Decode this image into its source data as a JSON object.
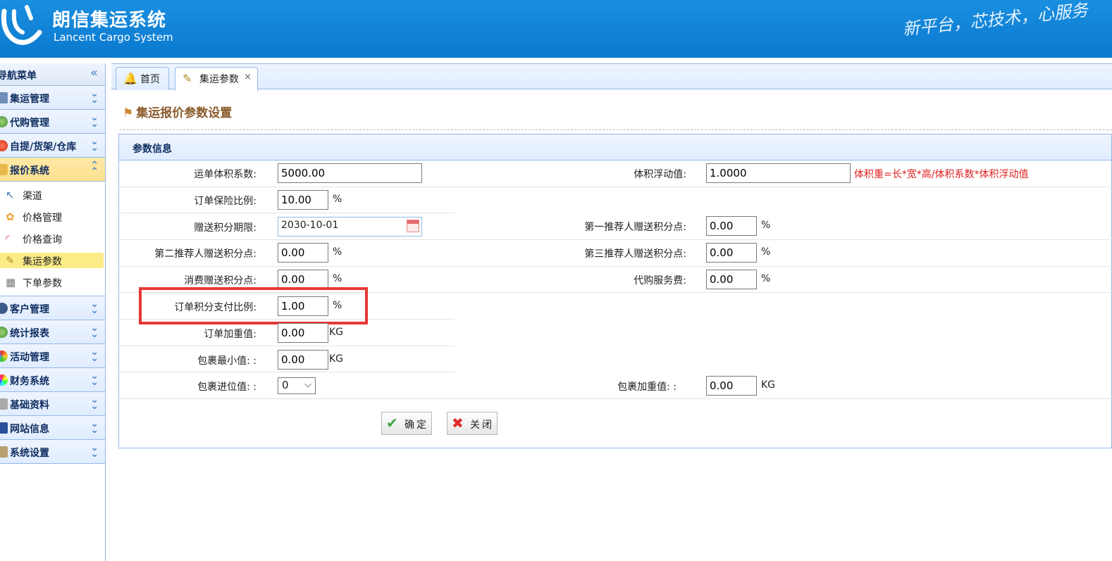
{
  "header": {
    "title": "朗信集运系统",
    "subtitle": "Lancent Cargo System",
    "slogan": "新平台，芯技术，心服务"
  },
  "nav": {
    "title": "导航菜单",
    "items": [
      {
        "label": "集运管理",
        "icon": "monitor-icon",
        "expanded": false
      },
      {
        "label": "代购管理",
        "icon": "globe-icon",
        "expanded": false
      },
      {
        "label": "自提/货架/仓库",
        "icon": "red-circle-icon",
        "expanded": false
      },
      {
        "label": "报价系统",
        "icon": "price-icon",
        "expanded": true,
        "children": [
          {
            "label": "渠道",
            "icon": "route-icon"
          },
          {
            "label": "价格管理",
            "icon": "flower-icon"
          },
          {
            "label": "价格查询",
            "icon": "rainbow-icon"
          },
          {
            "label": "集运参数",
            "icon": "pencil-icon",
            "selected": true
          },
          {
            "label": "下单参数",
            "icon": "grid-icon"
          }
        ]
      },
      {
        "label": "客户管理",
        "icon": "user-icon",
        "expanded": false
      },
      {
        "label": "统计报表",
        "icon": "globe-icon",
        "expanded": false
      },
      {
        "label": "活动管理",
        "icon": "rainbow-icon",
        "expanded": false
      },
      {
        "label": "财务系统",
        "icon": "color-wheel-icon",
        "expanded": false
      },
      {
        "label": "基础资料",
        "icon": "notes-icon",
        "expanded": false
      },
      {
        "label": "网站信息",
        "icon": "font-icon",
        "expanded": false
      },
      {
        "label": "系统设置",
        "icon": "wrench-icon",
        "expanded": false
      }
    ]
  },
  "tabs": [
    {
      "label": "首页",
      "icon": "bell-icon"
    },
    {
      "label": "集运参数",
      "icon": "pencil-icon",
      "close": "×",
      "active": true
    }
  ],
  "page": {
    "title": "集运报价参数设置",
    "panel_title": "参数信息"
  },
  "form": {
    "volume_coef": {
      "label": "运单体积系数:",
      "value": "5000.00"
    },
    "volume_float": {
      "label": "体积浮动值:",
      "value": "1.0000"
    },
    "volume_note": "体积重=长*宽*高/体积系数*体积浮动值",
    "insurance_ratio": {
      "label": "订单保险比例:",
      "value": "10.00",
      "unit": "%"
    },
    "points_expiry": {
      "label": "赠送积分期限:",
      "value": "2030-10-01"
    },
    "ref1_points": {
      "label": "第一推荐人赠送积分点:",
      "value": "0.00",
      "unit": "%"
    },
    "ref2_points": {
      "label": "第二推荐人赠送积分点:",
      "value": "0.00",
      "unit": "%"
    },
    "ref3_points": {
      "label": "第三推荐人赠送积分点:",
      "value": "0.00",
      "unit": "%"
    },
    "consume_points": {
      "label": "消费赠送积分点:",
      "value": "0.00",
      "unit": "%"
    },
    "purchase_fee": {
      "label": "代购服务费:",
      "value": "0.00",
      "unit": "%"
    },
    "points_pay_ratio": {
      "label": "订单积分支付比例:",
      "value": "1.00",
      "unit": "%"
    },
    "order_add_weight": {
      "label": "订单加重值:",
      "value": "0.00",
      "unit": "KG"
    },
    "parcel_min": {
      "label": "包裹最小值: :",
      "value": "0.00",
      "unit": "KG"
    },
    "parcel_round": {
      "label": "包裹进位值: :",
      "value": "0"
    },
    "parcel_add_weight": {
      "label": "包裹加重值: :",
      "value": "0.00",
      "unit": "KG"
    }
  },
  "buttons": {
    "confirm": "确定",
    "close": "关闭"
  },
  "colors": {
    "header_blue": "#0a79cf",
    "note_red": "#e02020",
    "highlight_red": "#e53935",
    "active_menu": "#fde08f"
  }
}
